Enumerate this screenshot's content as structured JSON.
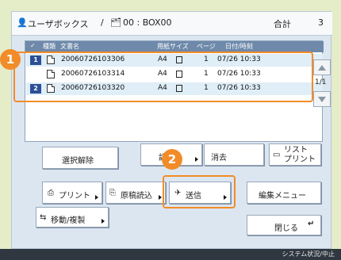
{
  "header": {
    "box_title": "ユーザボックス",
    "separator": "/",
    "box_id": "00 : BOX00",
    "total_label": "合計",
    "total_value": "3"
  },
  "table": {
    "columns": [
      "種類",
      "文書名",
      "用紙サイズ",
      "ページ",
      "日付/時刻"
    ],
    "rows": [
      {
        "num": "1",
        "name": "20060726103306",
        "size": "A4",
        "pages": "1",
        "datetime": "07/26 10:33",
        "selected": true
      },
      {
        "num": "",
        "name": "20060726103314",
        "size": "A4",
        "pages": "1",
        "datetime": "07/26 10:33",
        "selected": false
      },
      {
        "num": "2",
        "name": "20060726103320",
        "size": "A4",
        "pages": "1",
        "datetime": "07/26 10:33",
        "selected": true
      }
    ]
  },
  "page_indicator": "1/1",
  "buttons": {
    "deselect": "選択解除",
    "details": "詳細",
    "delete": "消去",
    "print_list": "リスト\nプリント",
    "print": "プリント",
    "scan_original": "原稿読込",
    "send": "送信",
    "edit_menu": "編集メニュー",
    "move_copy": "移動/複製",
    "close": "閉じる"
  },
  "callouts": {
    "one": "1",
    "two": "2"
  },
  "footer": {
    "status": "システム状況/中止"
  },
  "colors": {
    "accent": "#f28c28",
    "badge": "#2c4f96",
    "header": "#6e89aa"
  }
}
